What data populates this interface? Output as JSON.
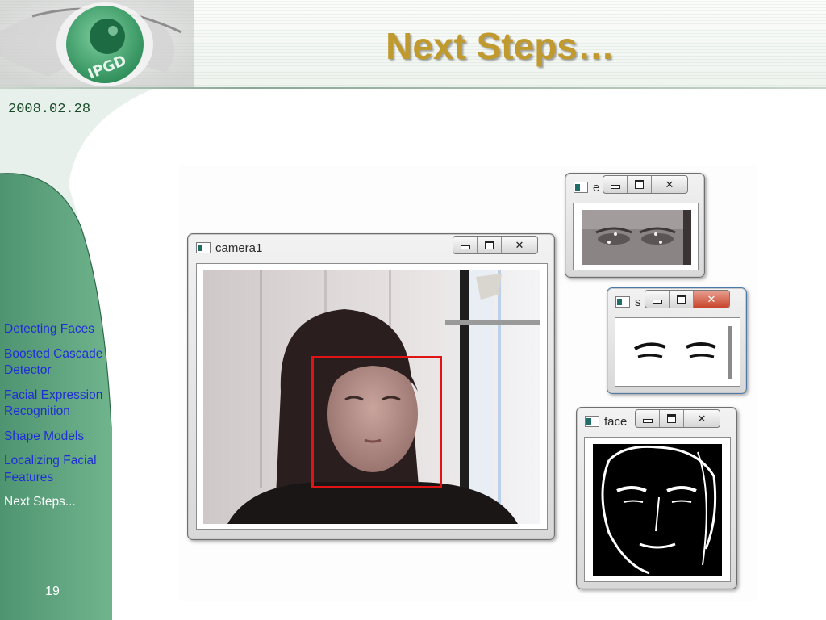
{
  "slide": {
    "title": "Next Steps…",
    "date": "2008.02.28",
    "logo_text": "IPGD",
    "page_number": "19"
  },
  "nav": {
    "items": [
      {
        "label": "Detecting Faces",
        "current": false
      },
      {
        "label": "Boosted Cascade Detector",
        "current": false
      },
      {
        "label": "Facial Expression Recognition",
        "current": false
      },
      {
        "label": "Shape Models",
        "current": false
      },
      {
        "label": "Localizing Facial Features",
        "current": false
      },
      {
        "label": "Next Steps...",
        "current": true
      }
    ]
  },
  "windows": {
    "camera": {
      "title": "camera1"
    },
    "eyes": {
      "title": "e"
    },
    "shape": {
      "title": "s"
    },
    "face": {
      "title": "face"
    }
  },
  "icons": [
    "app-window-icon",
    "minimize-icon",
    "maximize-icon",
    "close-icon"
  ],
  "colors": {
    "title": "#c09a2e",
    "sidebar": "#5a9e79",
    "nav_link": "#1f2fd6",
    "nav_current": "#ffffff",
    "detection_box": "#e01414"
  }
}
